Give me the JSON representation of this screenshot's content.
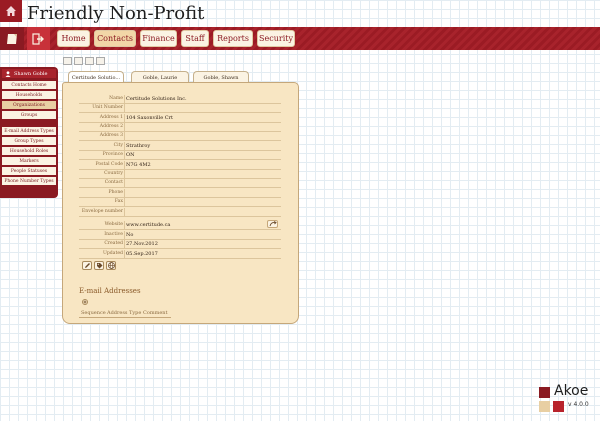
{
  "app": {
    "title": "Friendly Non-Profit"
  },
  "nav": {
    "items": [
      "Home",
      "Contacts",
      "Finance",
      "Staff",
      "Reports",
      "Security"
    ],
    "active": "Contacts"
  },
  "sidebar": {
    "user": "Shawn Goble",
    "items": [
      "Contacts Home",
      "Households",
      "Organizations",
      "Groups"
    ],
    "admin_items": [
      "E-mail Address Types",
      "Group Types",
      "Household Roles",
      "Markers",
      "People Statuses",
      "Phone Number Types"
    ],
    "active": "Organizations"
  },
  "tabs": [
    "Certitude Solutio...",
    "Goble, Laurie",
    "Goble, Shawn"
  ],
  "record": {
    "fields": [
      {
        "label": "Name",
        "value": "Certitude Solutions Inc."
      },
      {
        "label": "Unit Number",
        "value": ""
      },
      {
        "label": "Address 1",
        "value": "104 Saxonville Crt"
      },
      {
        "label": "Address 2",
        "value": ""
      },
      {
        "label": "Address 3",
        "value": ""
      },
      {
        "label": "City",
        "value": "Strathroy"
      },
      {
        "label": "Province",
        "value": "ON"
      },
      {
        "label": "Postal Code",
        "value": "N7G 4M2"
      },
      {
        "label": "Country",
        "value": ""
      },
      {
        "label": "Contact",
        "value": ""
      },
      {
        "label": "Phone",
        "value": ""
      },
      {
        "label": "Fax",
        "value": ""
      },
      {
        "label": "Envelope number",
        "value": ""
      },
      {
        "label": "Website",
        "value": "www.certitude.ca"
      },
      {
        "label": "Inactive",
        "value": "No"
      },
      {
        "label": "Created",
        "value": "27.Nov.2012"
      },
      {
        "label": "Updated",
        "value": "05.Sep.2017"
      }
    ]
  },
  "email": {
    "title": "E-mail Addresses",
    "columns": [
      "Sequence",
      "Address",
      "Type",
      "Comment"
    ]
  },
  "brand": {
    "name": "Akoe",
    "version": "v 4.0.0"
  },
  "icons": {
    "home": "home-icon",
    "note": "note-icon",
    "exit": "exit-icon",
    "user": "user-icon",
    "link": "link-icon",
    "edit": "edit-icon",
    "tag": "tag-icon",
    "globe": "globe-icon",
    "add": "add-icon"
  },
  "colors": {
    "brand_red": "#9b1b24",
    "panel": "#f8e6c3",
    "accent": "#8a1a22"
  }
}
